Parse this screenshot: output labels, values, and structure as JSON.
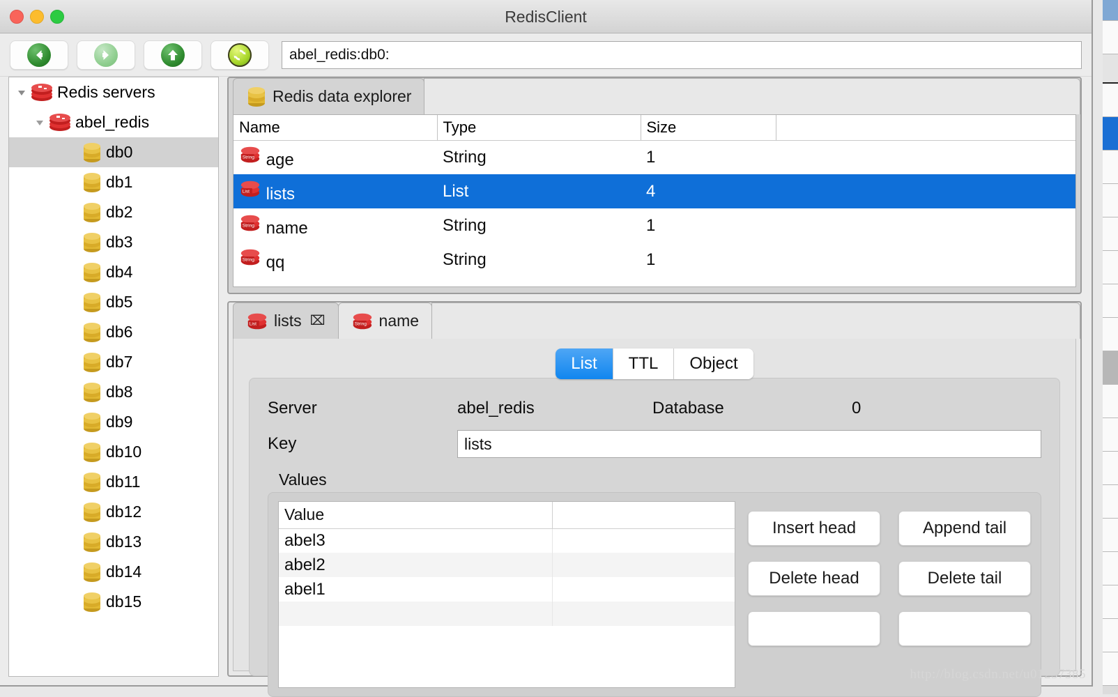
{
  "window": {
    "title": "RedisClient",
    "traffic_lights": [
      "close",
      "minimize",
      "maximize"
    ]
  },
  "toolbar": {
    "back_label": "back-arrow",
    "forward_label": "forward-arrow",
    "up_label": "up-arrow",
    "refresh_label": "refresh-arrows",
    "address_value": "abel_redis:db0:",
    "address_placeholder": ""
  },
  "sidebar": {
    "items": [
      {
        "label": "Redis servers",
        "icon": "redis-cube-icon",
        "level": 1,
        "twisty": "down",
        "selected": false
      },
      {
        "label": "abel_redis",
        "icon": "redis-cube-icon",
        "level": 2,
        "twisty": "down",
        "selected": false
      },
      {
        "label": "db0",
        "icon": "database-icon",
        "level": 3,
        "twisty": "none",
        "selected": true
      },
      {
        "label": "db1",
        "icon": "database-icon",
        "level": 3,
        "twisty": "none",
        "selected": false
      },
      {
        "label": "db2",
        "icon": "database-icon",
        "level": 3,
        "twisty": "none",
        "selected": false
      },
      {
        "label": "db3",
        "icon": "database-icon",
        "level": 3,
        "twisty": "none",
        "selected": false
      },
      {
        "label": "db4",
        "icon": "database-icon",
        "level": 3,
        "twisty": "none",
        "selected": false
      },
      {
        "label": "db5",
        "icon": "database-icon",
        "level": 3,
        "twisty": "none",
        "selected": false
      },
      {
        "label": "db6",
        "icon": "database-icon",
        "level": 3,
        "twisty": "none",
        "selected": false
      },
      {
        "label": "db7",
        "icon": "database-icon",
        "level": 3,
        "twisty": "none",
        "selected": false
      },
      {
        "label": "db8",
        "icon": "database-icon",
        "level": 3,
        "twisty": "none",
        "selected": false
      },
      {
        "label": "db9",
        "icon": "database-icon",
        "level": 3,
        "twisty": "none",
        "selected": false
      },
      {
        "label": "db10",
        "icon": "database-icon",
        "level": 3,
        "twisty": "none",
        "selected": false
      },
      {
        "label": "db11",
        "icon": "database-icon",
        "level": 3,
        "twisty": "none",
        "selected": false
      },
      {
        "label": "db12",
        "icon": "database-icon",
        "level": 3,
        "twisty": "none",
        "selected": false
      },
      {
        "label": "db13",
        "icon": "database-icon",
        "level": 3,
        "twisty": "none",
        "selected": false
      },
      {
        "label": "db14",
        "icon": "database-icon",
        "level": 3,
        "twisty": "none",
        "selected": false
      },
      {
        "label": "db15",
        "icon": "database-icon",
        "level": 3,
        "twisty": "none",
        "selected": false
      }
    ]
  },
  "explorer": {
    "tab_label": "Redis data explorer",
    "tab_icon": "database-icon",
    "columns": [
      "Name",
      "Type",
      "Size",
      ""
    ],
    "rows": [
      {
        "name": "age",
        "type": "String",
        "size": "1",
        "icon": "redis-string-icon",
        "selected": false
      },
      {
        "name": "lists",
        "type": "List",
        "size": "4",
        "icon": "redis-list-icon",
        "selected": true
      },
      {
        "name": "name",
        "type": "String",
        "size": "1",
        "icon": "redis-string-icon",
        "selected": false
      },
      {
        "name": "qq",
        "type": "String",
        "size": "1",
        "icon": "redis-string-icon",
        "selected": false
      }
    ]
  },
  "detail": {
    "tabs": [
      {
        "label": "lists",
        "icon": "redis-list-icon",
        "active": true,
        "closable": true,
        "close_glyph": "⌧"
      },
      {
        "label": "name",
        "icon": "redis-string-icon",
        "active": false,
        "closable": false,
        "close_glyph": ""
      }
    ],
    "segments": [
      {
        "label": "List",
        "active": true
      },
      {
        "label": "TTL",
        "active": false
      },
      {
        "label": "Object",
        "active": false
      }
    ],
    "server_label": "Server",
    "server_value": "abel_redis",
    "database_label": "Database",
    "database_value": "0",
    "key_label": "Key",
    "key_value": "lists",
    "values_legend": "Values",
    "values_columns": [
      "Value",
      ""
    ],
    "values_rows": [
      "abel3",
      "abel2",
      "abel1"
    ],
    "buttons": [
      "Insert head",
      "Append tail",
      "Delete head",
      "Delete tail"
    ]
  },
  "watermark": {
    "text": "http://blog.csdn.net/u01237385"
  },
  "colors": {
    "selection_blue": "#0f6fd8",
    "segment_blue": "#1186ef",
    "redis_red": "#d42a2a",
    "database_gold": "#d6a828",
    "arrow_green": "#2f8b2f"
  }
}
